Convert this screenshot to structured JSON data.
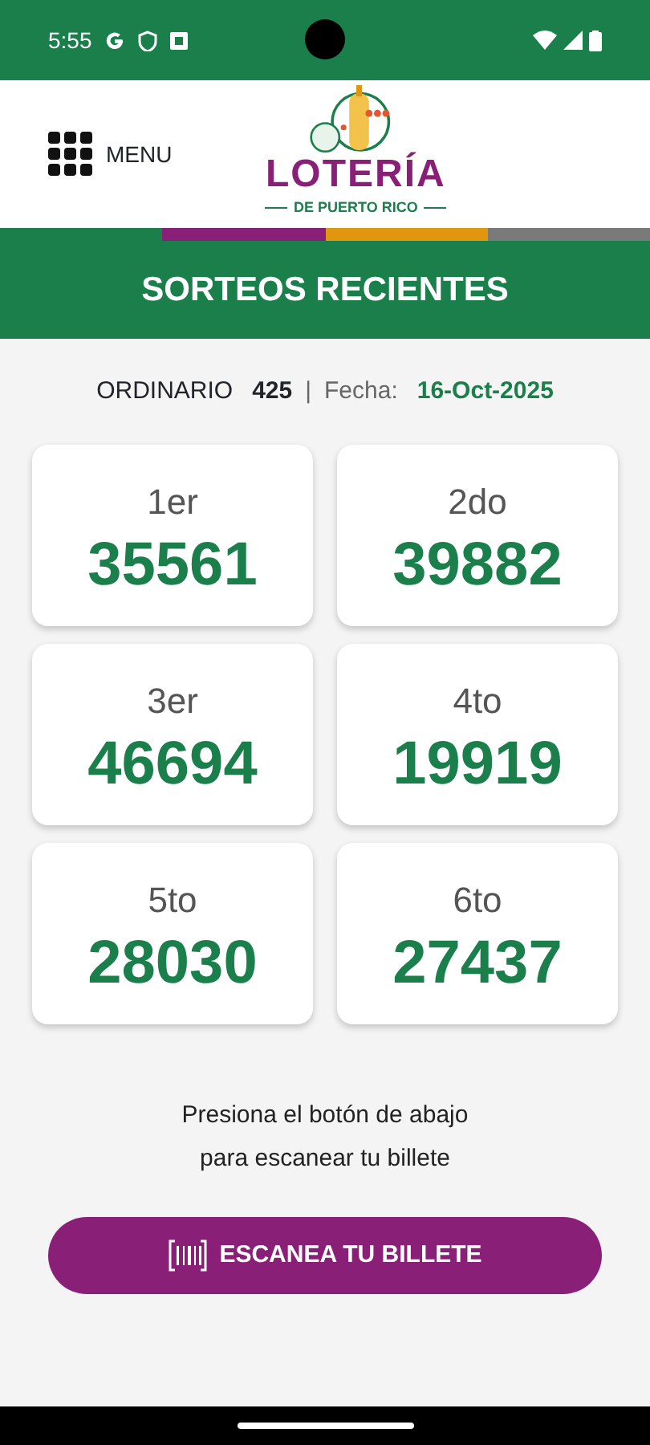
{
  "status_bar": {
    "time": "5:55"
  },
  "header": {
    "menu_label": "MENU",
    "logo_title": "LOTERÍA",
    "logo_subtitle": "DE PUERTO RICO"
  },
  "title": "SORTEOS RECIENTES",
  "draw_info": {
    "type_label": "ORDINARIO",
    "number": "425",
    "separator": "|",
    "date_label": "Fecha:",
    "date": "16-Oct-2025"
  },
  "prizes": [
    {
      "place": "1er",
      "number": "35561"
    },
    {
      "place": "2do",
      "number": "39882"
    },
    {
      "place": "3er",
      "number": "46694"
    },
    {
      "place": "4to",
      "number": "19919"
    },
    {
      "place": "5to",
      "number": "28030"
    },
    {
      "place": "6to",
      "number": "27437"
    }
  ],
  "instructions": [
    "Presiona el botón de abajo",
    "para escanear tu billete"
  ],
  "scan_button": "ESCANEA TU BILLETE"
}
